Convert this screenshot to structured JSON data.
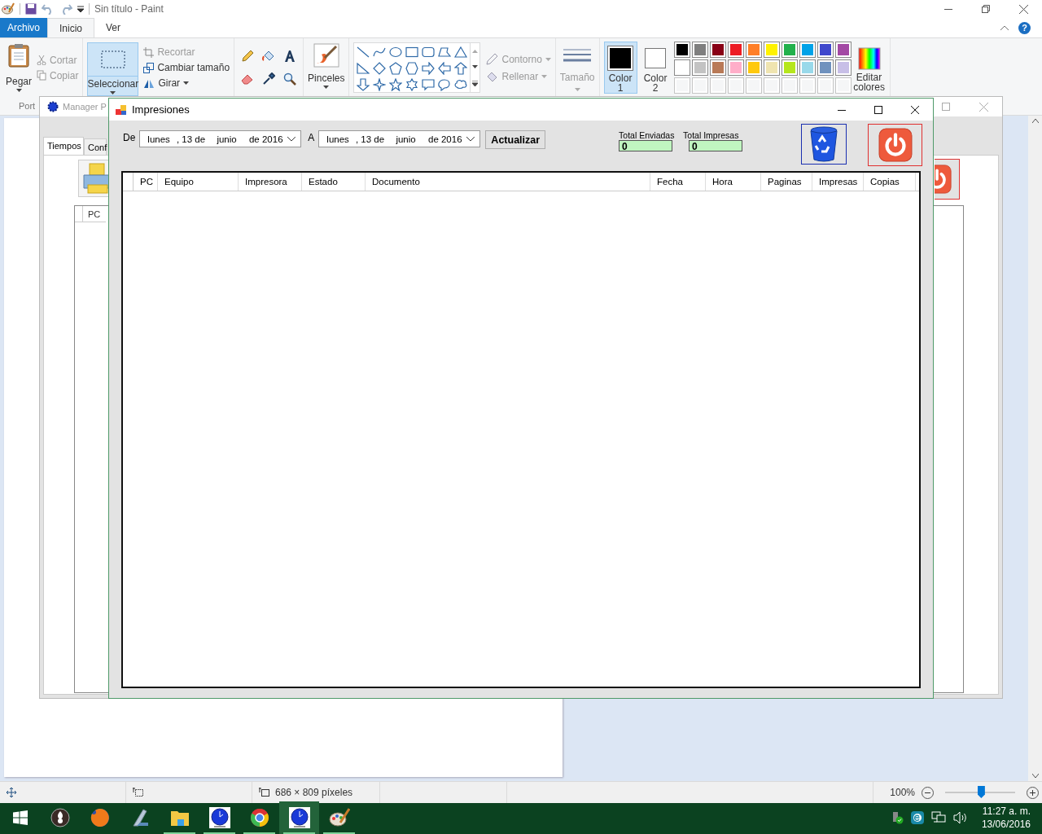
{
  "paint": {
    "title": "Sin título - Paint",
    "tabs": [
      {
        "label": "Archivo",
        "kind": "file",
        "selected": false
      },
      {
        "label": "Inicio",
        "kind": "tab",
        "selected": true
      },
      {
        "label": "Ver",
        "kind": "tab",
        "selected": false
      }
    ],
    "help": "?",
    "ribbon": {
      "paste": {
        "label": "Pegar"
      },
      "clipboard_items": [
        {
          "label": "Cortar",
          "disabled": true
        },
        {
          "label": "Copiar",
          "disabled": true
        }
      ],
      "select": {
        "label": "Seleccionar",
        "selected": true
      },
      "image_items": [
        {
          "label": "Recortar",
          "disabled": true
        },
        {
          "label": "Cambiar tamaño",
          "disabled": false
        },
        {
          "label": "Girar",
          "disabled": false
        }
      ],
      "brushes": {
        "label": "Pinceles"
      },
      "shape_options": [
        {
          "label": "Contorno",
          "disabled": true
        },
        {
          "label": "Rellenar",
          "disabled": true
        }
      ],
      "size": {
        "label": "Tamaño",
        "disabled": true
      },
      "colors": [
        {
          "label": "Color 1",
          "color": "#000000",
          "selected": true
        },
        {
          "label": "Color 2",
          "color": "#ffffff",
          "selected": false
        }
      ],
      "palette": [
        {
          "color": "#000000"
        },
        {
          "color": "#7f7f7f"
        },
        {
          "color": "#880015"
        },
        {
          "color": "#ed1c24"
        },
        {
          "color": "#ff7f27"
        },
        {
          "color": "#fff200"
        },
        {
          "color": "#22b14c"
        },
        {
          "color": "#00a2e8"
        },
        {
          "color": "#3f48cc"
        },
        {
          "color": "#a349a4"
        },
        {
          "color": "#ffffff"
        },
        {
          "color": "#c3c3c3"
        },
        {
          "color": "#b97a57"
        },
        {
          "color": "#ffaec9"
        },
        {
          "color": "#ffc90e"
        },
        {
          "color": "#efe4b0"
        },
        {
          "color": "#b5e61d"
        },
        {
          "color": "#99d9ea"
        },
        {
          "color": "#7092be"
        },
        {
          "color": "#c8bfe7"
        }
      ],
      "edit_colors": {
        "label": "Editar colores"
      },
      "group_label": "Port"
    },
    "status": {
      "size": "686 × 809 píxeles",
      "zoom": "100%",
      "zoom_slider": {
        "level": 0.51
      }
    }
  },
  "manager_window": {
    "title": "Manager P",
    "tabs": [
      {
        "label": "Tiempos",
        "selected": true
      },
      {
        "label": "Conf",
        "selected": false
      }
    ],
    "columns": [
      "PC"
    ]
  },
  "impresiones": {
    "title": "Impresiones",
    "from_label": "De",
    "from_date": [
      "lunes",
      ", 13 de",
      "junio",
      "de 2016"
    ],
    "to_label": "A",
    "to_date": [
      "lunes",
      ", 13 de",
      "junio",
      "de 2016"
    ],
    "refresh": "Actualizar",
    "totals": [
      {
        "label": "Total Enviadas",
        "value": "0"
      },
      {
        "label": "Total Impresas",
        "value": "0"
      }
    ],
    "columns": [
      "PC",
      "Equipo",
      "Impresora",
      "Estado",
      "Documento",
      "Fecha",
      "Hora",
      "Paginas",
      "Impresas",
      "Copias"
    ]
  },
  "taskbar": {
    "items": [
      {
        "kind": "start",
        "running": false,
        "selected": false
      },
      {
        "kind": "burner",
        "running": false,
        "selected": false
      },
      {
        "kind": "firefox",
        "running": false,
        "selected": false
      },
      {
        "kind": "scanner",
        "running": false,
        "selected": false
      },
      {
        "kind": "folder",
        "running": true,
        "selected": false
      },
      {
        "kind": "globe",
        "running": true,
        "selected": false
      },
      {
        "kind": "chrome",
        "running": true,
        "selected": false
      },
      {
        "kind": "globe",
        "running": true,
        "selected": true
      },
      {
        "kind": "paint",
        "running": true,
        "selected": false
      }
    ],
    "time": "11:27 a. m.",
    "date": "13/06/2016"
  }
}
